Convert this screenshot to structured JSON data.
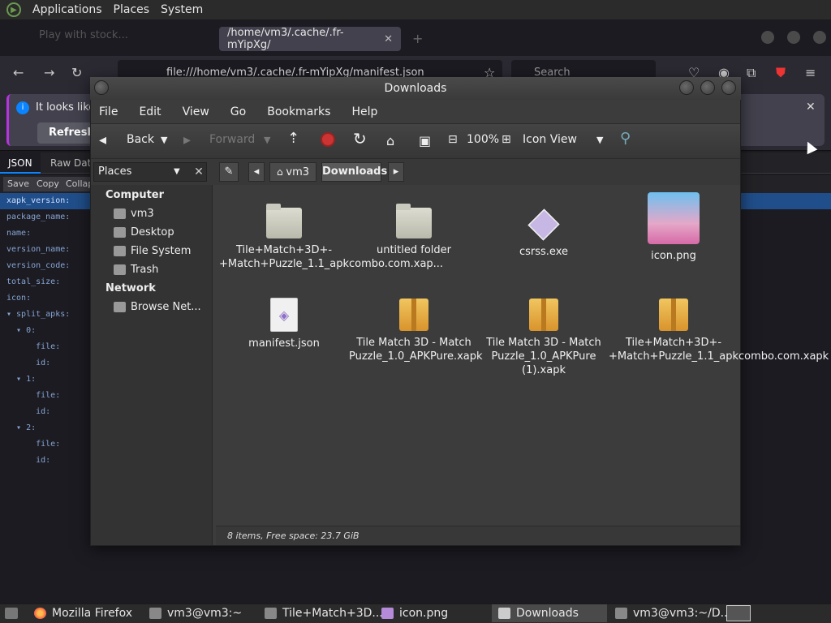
{
  "top_panel": {
    "menus": [
      "Applications",
      "Places",
      "System"
    ]
  },
  "firefox": {
    "tab_inactive": "Play with stock...",
    "tab_active": "/home/vm3/.cache/.fr-mYipXg/",
    "url": "file:///home/vm3/.cache/.fr-mYipXg/manifest.json",
    "search_placeholder": "Search",
    "notice_text": "It looks like",
    "refresh_label": "Refresh",
    "json_tabs": [
      "JSON",
      "Raw Data"
    ],
    "json_buttons": [
      "Save",
      "Copy",
      "Collap"
    ],
    "json_rows": [
      "xapk_version:",
      "package_name:",
      "name:",
      "version_name:",
      "version_code:",
      "total_size:",
      "icon:",
      "▾ split_apks:",
      "  ▾ 0:",
      "      file:",
      "      id:",
      "  ▾ 1:",
      "      file:",
      "      id:",
      "  ▾ 2:",
      "      file:",
      "      id:"
    ]
  },
  "nautilus": {
    "title": "Downloads",
    "menus": [
      "File",
      "Edit",
      "View",
      "Go",
      "Bookmarks",
      "Help"
    ],
    "toolbar": {
      "back": "Back",
      "forward": "Forward",
      "zoom": "100%",
      "view_mode": "Icon View"
    },
    "places_label": "Places",
    "breadcrumbs": [
      "vm3",
      "Downloads"
    ],
    "sidebar": {
      "computer_header": "Computer",
      "computer_items": [
        "vm3",
        "Desktop",
        "File System",
        "Trash"
      ],
      "network_header": "Network",
      "network_items": [
        "Browse Net..."
      ]
    },
    "files": [
      {
        "name": "Tile+Match+3D+-+Match+Puzzle_1.1_apkcombo.com.xap...",
        "type": "folder"
      },
      {
        "name": "untitled folder",
        "type": "folder"
      },
      {
        "name": "csrss.exe",
        "type": "exe"
      },
      {
        "name": "icon.png",
        "type": "image"
      },
      {
        "name": "manifest.json",
        "type": "json"
      },
      {
        "name": "Tile Match 3D - Match Puzzle_1.0_APKPure.xapk",
        "type": "package"
      },
      {
        "name": "Tile Match 3D - Match Puzzle_1.0_APKPure (1).xapk",
        "type": "package"
      },
      {
        "name": "Tile+Match+3D+-+Match+Puzzle_1.1_apkcombo.com.xapk",
        "type": "package"
      }
    ],
    "status": "8 items, Free space: 23.7 GiB"
  },
  "taskbar": {
    "tasks": [
      "Mozilla Firefox",
      "vm3@vm3:~",
      "Tile+Match+3D...",
      "icon.png",
      "Downloads",
      "vm3@vm3:~/D..."
    ]
  }
}
